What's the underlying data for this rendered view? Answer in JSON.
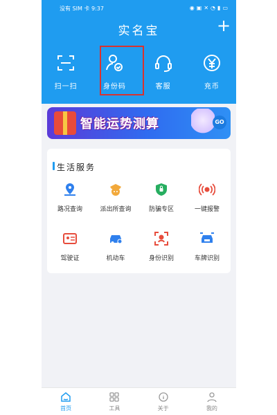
{
  "status_bar": {
    "carrier": "没有 SIM 卡 9:37"
  },
  "header": {
    "title": "实名宝",
    "plus_label": "+",
    "quick_actions": [
      {
        "label": "扫一扫",
        "icon": "scan-icon"
      },
      {
        "label": "身份码",
        "icon": "id-code-icon"
      },
      {
        "label": "客服",
        "icon": "headset-icon"
      },
      {
        "label": "充币",
        "icon": "yen-coin-icon"
      }
    ]
  },
  "banner": {
    "text": "智能运势测算",
    "go_label": "GO"
  },
  "services": {
    "title": "生活服务",
    "items": [
      {
        "label": "路况查询",
        "icon": "map-pin-icon",
        "color": "#2f80ed"
      },
      {
        "label": "派出所查询",
        "icon": "police-icon",
        "color": "#f2a93b"
      },
      {
        "label": "防骗专区",
        "icon": "shield-icon",
        "color": "#27ae60"
      },
      {
        "label": "一键报警",
        "icon": "alarm-icon",
        "color": "#e74c3c"
      },
      {
        "label": "驾驶证",
        "icon": "license-icon",
        "color": "#e74c3c"
      },
      {
        "label": "机动车",
        "icon": "car-icon",
        "color": "#2f80ed"
      },
      {
        "label": "身份识别",
        "icon": "face-scan-icon",
        "color": "#e74c3c"
      },
      {
        "label": "车牌识别",
        "icon": "plate-scan-icon",
        "color": "#2f80ed"
      }
    ]
  },
  "tabbar": {
    "tabs": [
      {
        "label": "首页",
        "icon": "home-icon",
        "active": true
      },
      {
        "label": "工具",
        "icon": "tools-icon",
        "active": false
      },
      {
        "label": "关于",
        "icon": "about-icon",
        "active": false
      },
      {
        "label": "我的",
        "icon": "profile-icon",
        "active": false
      }
    ]
  },
  "colors": {
    "primary": "#1f9cf0",
    "highlight_border": "#d9322f"
  }
}
